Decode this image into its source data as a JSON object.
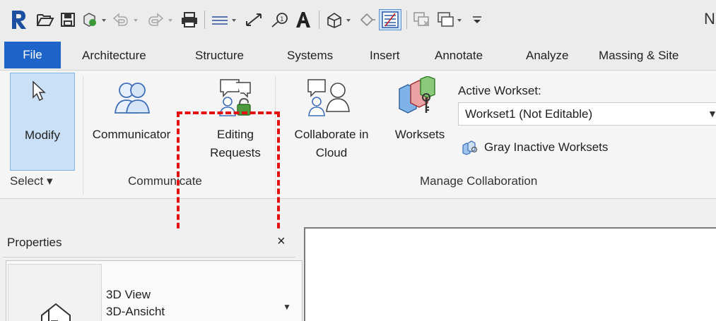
{
  "quick_access": {
    "app_logo": "R",
    "title_fragment": "N",
    "icons": [
      "revit-logo-icon",
      "open-icon",
      "save-icon",
      "sync-icon",
      "undo-icon",
      "redo-icon",
      "print-icon",
      "measure-icon",
      "dimension-icon",
      "tag-icon",
      "text-icon",
      "3d-view-icon",
      "section-icon",
      "thin-lines-icon",
      "close-hidden-icon",
      "switch-windows-icon",
      "customize-qat-icon"
    ]
  },
  "tabs": {
    "file": "File",
    "architecture": "Architecture",
    "structure": "Structure",
    "systems": "Systems",
    "insert": "Insert",
    "annotate": "Annotate",
    "analyze": "Analyze",
    "massing": "Massing & Site"
  },
  "ribbon": {
    "select_panel": {
      "modify_label": "Modify",
      "panel_label": "Select ▾"
    },
    "communicate_panel": {
      "communicator_label": "Communicator",
      "editing_requests_line1": "Editing",
      "editing_requests_line2": "Requests",
      "panel_label": "Communicate"
    },
    "manage_collaboration_panel": {
      "collaborate_line1": "Collaborate in",
      "collaborate_line2": "Cloud",
      "worksets_label": "Worksets",
      "active_workset_label": "Active Workset:",
      "active_workset_value": "Workset1 (Not Editable)",
      "gray_inactive_label": "Gray Inactive Worksets",
      "panel_label": "Manage Collaboration"
    }
  },
  "properties": {
    "title": "Properties",
    "close_glyph": "×",
    "type_name_line1": "3D View",
    "type_name_line2": "3D-Ansicht"
  },
  "colors": {
    "file_tab": "#1e64c8",
    "highlight": "#e21010",
    "modify_active": "#c9e0f7"
  }
}
